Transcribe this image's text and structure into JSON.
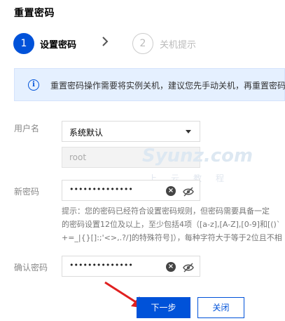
{
  "header": {
    "title": "重置密码"
  },
  "steps": [
    {
      "number": "1",
      "label": "设置密码",
      "state": "active"
    },
    {
      "number": "2",
      "label": "关机提示",
      "state": "inactive"
    }
  ],
  "notice": {
    "icon": "info-icon",
    "text": "重置密码操作需要将实例关机，建议您先手动关机，再重置密码"
  },
  "form": {
    "username": {
      "label": "用户名",
      "selected": "系统默认",
      "readonly_value": "root"
    },
    "new_password": {
      "label": "新密码",
      "masked_value": "••••••••••••••"
    },
    "hint": {
      "lines": [
        "提示：您的密码已经符合设置密码规则，但密码需要具备一定",
        "的密码设置12位及以上，至少包括4项（[a-z],[A-Z],[0-9]和[()`",
        "+=_|{}[]:;'<>,.?/]的特殊符号]），每种字符大于等于2位且不相"
      ]
    },
    "confirm_password": {
      "label": "确认密码",
      "masked_value": "••••••••••••••"
    }
  },
  "watermark": {
    "main": "Syunz.com",
    "sub": "上云教程"
  },
  "actions": {
    "next_label": "下一步",
    "close_label": "关闭"
  },
  "colors": {
    "primary": "#0052d9",
    "notice_bg": "#e5f0ff",
    "annotation_arrow": "#e02020"
  }
}
